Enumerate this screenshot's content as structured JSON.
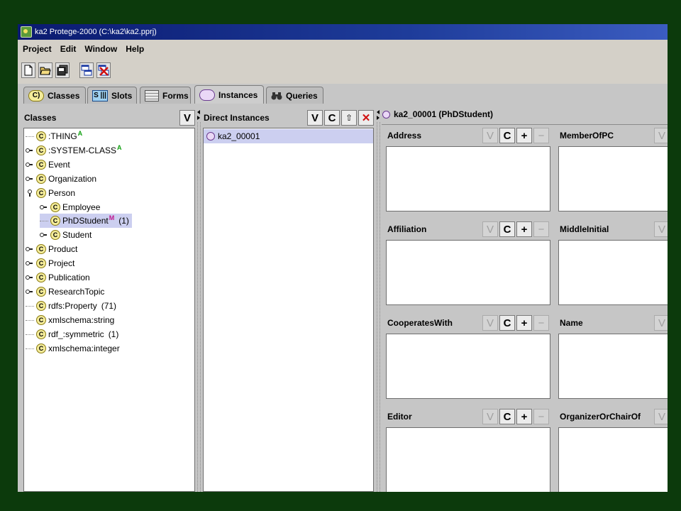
{
  "window": {
    "title": "ka2  Protege-2000    (C:\\ka2\\ka2.pprj)"
  },
  "menu": [
    "Project",
    "Edit",
    "Window",
    "Help"
  ],
  "toolbar": [
    {
      "name": "new-project-icon"
    },
    {
      "name": "open-project-icon"
    },
    {
      "name": "save-project-icon"
    },
    {
      "name": "cascade-windows-icon"
    },
    {
      "name": "close-windows-icon"
    }
  ],
  "tabs": [
    {
      "label": "Classes",
      "icon": "class-icon",
      "icon_text": "C)"
    },
    {
      "label": "Slots",
      "icon": "slot-icon",
      "icon_text": "S"
    },
    {
      "label": "Forms",
      "icon": "form-icon",
      "icon_text": ""
    },
    {
      "label": "Instances",
      "icon": "instance-icon",
      "icon_text": "",
      "active": true
    },
    {
      "label": "Queries",
      "icon": "binoculars-icon",
      "icon_text": ""
    }
  ],
  "classes_panel": {
    "title": "Classes",
    "view_button": "V",
    "tree": [
      {
        "label": ":THING",
        "mark": "A",
        "expander": "none",
        "depth": 0
      },
      {
        "label": ":SYSTEM-CLASS",
        "mark": "A",
        "expander": "closed",
        "depth": 0
      },
      {
        "label": "Event",
        "expander": "closed",
        "depth": 0
      },
      {
        "label": "Organization",
        "expander": "closed",
        "depth": 0
      },
      {
        "label": "Person",
        "expander": "open",
        "depth": 0
      },
      {
        "label": "Employee",
        "expander": "closed",
        "depth": 1
      },
      {
        "label": "PhDStudent",
        "mark": "M",
        "count": "(1)",
        "expander": "none",
        "depth": 1,
        "selected": true
      },
      {
        "label": "Student",
        "expander": "closed",
        "depth": 1
      },
      {
        "label": "Product",
        "expander": "closed",
        "depth": 0
      },
      {
        "label": "Project",
        "expander": "closed",
        "depth": 0
      },
      {
        "label": "Publication",
        "expander": "closed",
        "depth": 0
      },
      {
        "label": "ResearchTopic",
        "expander": "closed",
        "depth": 0
      },
      {
        "label": "rdfs:Property",
        "count": "(71)",
        "expander": "none",
        "depth": 0
      },
      {
        "label": "xmlschema:string",
        "expander": "none",
        "depth": 0
      },
      {
        "label": "rdf_:symmetric",
        "count": "(1)",
        "expander": "none",
        "depth": 0
      },
      {
        "label": "xmlschema:integer",
        "expander": "none",
        "depth": 0
      }
    ]
  },
  "instances_panel": {
    "title": "Direct Instances",
    "buttons": {
      "view": "V",
      "create": "C",
      "copy": "⇧",
      "delete": "✕"
    },
    "items": [
      "ka2_00001"
    ]
  },
  "form_panel": {
    "title": "ka2_00001  (PhDStudent)",
    "buttons": {
      "view": "V",
      "create": "C",
      "add": "+",
      "remove": "−"
    },
    "slots_left": [
      "Address",
      "Affiliation",
      "CooperatesWith",
      "Editor"
    ],
    "slots_right": [
      "MemberOfPC",
      "MiddleInitial",
      "Name",
      "OrganizerOrChairOf"
    ]
  },
  "colors": {
    "selection": "#cccff0",
    "desktop": "#0c3a0c",
    "panel": "#c6c6c6"
  }
}
